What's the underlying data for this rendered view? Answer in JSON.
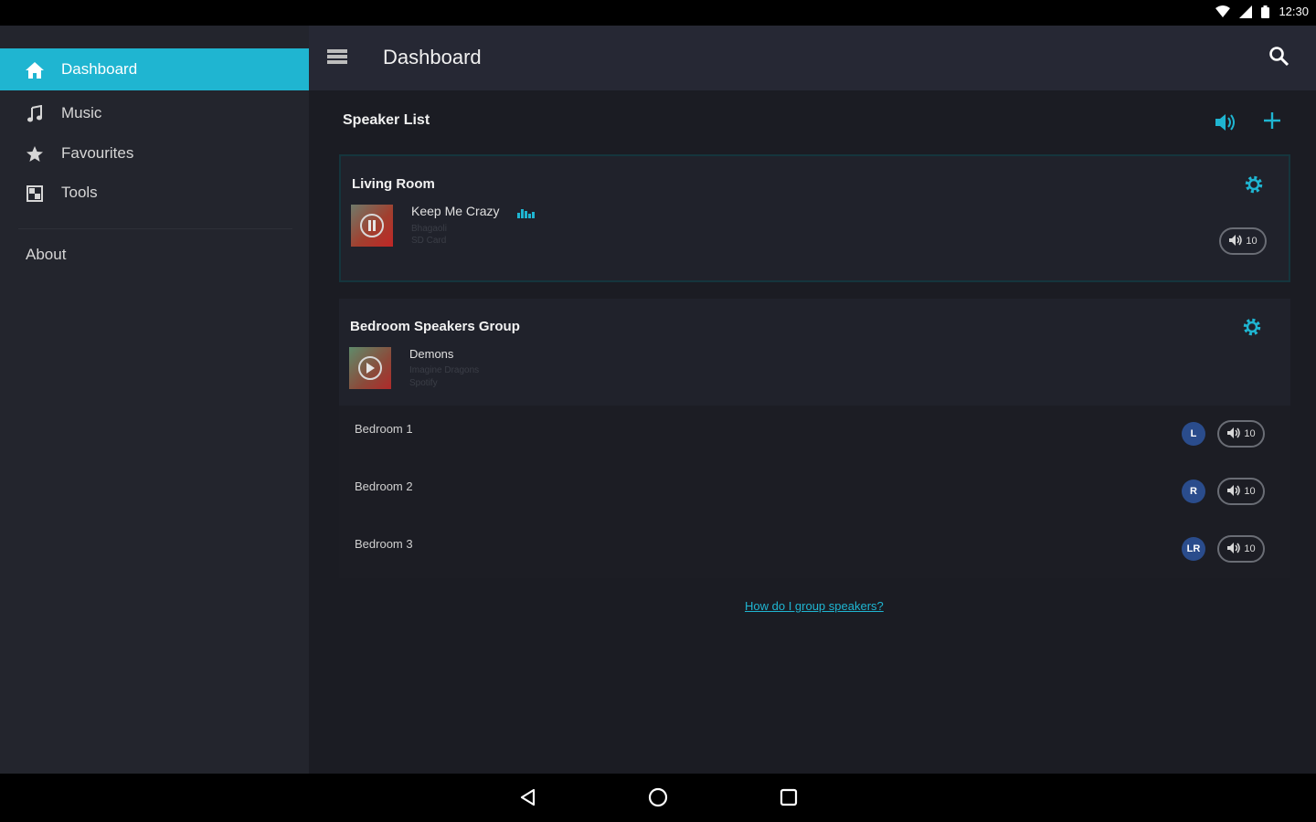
{
  "status_bar": {
    "time": "12:30",
    "icons": [
      "wifi-icon",
      "cell-signal-icon",
      "battery-icon"
    ]
  },
  "sidebar": {
    "items": [
      {
        "label": "Dashboard",
        "icon": "home-icon",
        "active": true
      },
      {
        "label": "Music",
        "icon": "music-note-icon",
        "active": false
      },
      {
        "label": "Favourites",
        "icon": "star-icon",
        "active": false
      },
      {
        "label": "Tools",
        "icon": "tools-icon",
        "active": false
      }
    ],
    "about_label": "About"
  },
  "app_bar": {
    "title": "Dashboard",
    "menu_icon": "menu-icon",
    "search_icon": "search-icon"
  },
  "main": {
    "section_title": "Speaker List",
    "speakers": [
      {
        "name": "Living Room",
        "track": "Keep Me Crazy",
        "line2": "Bhagaoli",
        "line3": "SD Card",
        "state": "playing",
        "volume": "10"
      }
    ],
    "group": {
      "name": "Bedroom Speakers Group",
      "track": "Demons",
      "line2": "Imagine Dragons",
      "line3": "Spotify",
      "state": "paused",
      "members": [
        {
          "name": "Bedroom 1",
          "channel": "L",
          "volume": "10"
        },
        {
          "name": "Bedroom 2",
          "channel": "R",
          "volume": "10"
        },
        {
          "name": "Bedroom 3",
          "channel": "LR",
          "volume": "10"
        }
      ]
    },
    "help_link": "How do I group speakers?"
  },
  "colors": {
    "accent": "#1fb5d1",
    "badge": "#2a4c8c",
    "sidebar_bg": "#23252d",
    "main_bg": "#1b1c23"
  },
  "system_nav": {
    "buttons": [
      "back-icon",
      "home-circle-icon",
      "recents-icon"
    ]
  }
}
